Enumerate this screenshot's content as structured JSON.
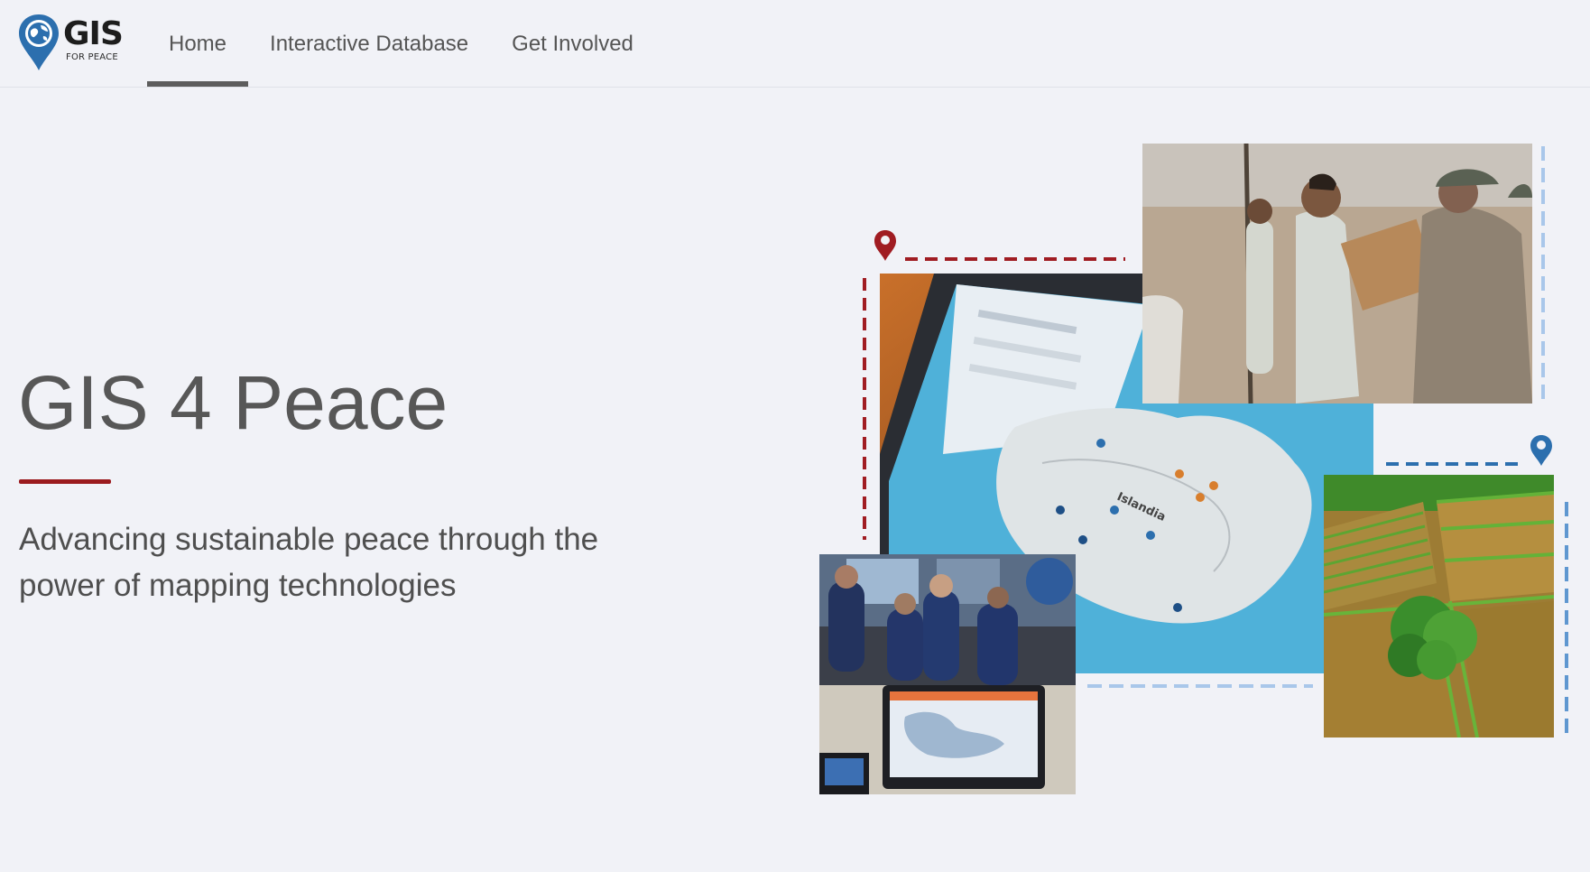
{
  "app": {
    "logo_word": "GIS",
    "logo_sub": "FOR PEACE"
  },
  "nav": {
    "items": [
      {
        "label": "Home",
        "active": true
      },
      {
        "label": "Interactive Database",
        "active": false
      },
      {
        "label": "Get Involved",
        "active": false
      }
    ]
  },
  "hero": {
    "title": "GIS 4 Peace",
    "subtitle": "Advancing sustainable peace through the power of mapping technologies"
  },
  "collage": {
    "map_label": "Islandia"
  },
  "colors": {
    "accent_red": "#9b1b1f",
    "accent_blue": "#2c6fae",
    "light_blue": "#a9c7ea",
    "background": "#f1f2f7"
  },
  "icons": [
    "map-pin-logo-icon",
    "red-location-pin-icon",
    "blue-location-pin-icon"
  ]
}
